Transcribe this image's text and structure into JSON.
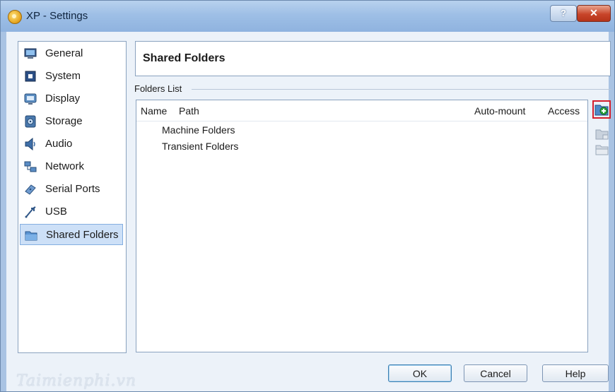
{
  "window": {
    "title": "XP - Settings",
    "help_glyph": "?",
    "close_glyph": "✕"
  },
  "sidebar": {
    "items": [
      {
        "label": "General",
        "icon": "monitor-icon"
      },
      {
        "label": "System",
        "icon": "chip-icon"
      },
      {
        "label": "Display",
        "icon": "display-icon"
      },
      {
        "label": "Storage",
        "icon": "storage-icon"
      },
      {
        "label": "Audio",
        "icon": "speaker-icon"
      },
      {
        "label": "Network",
        "icon": "network-icon"
      },
      {
        "label": "Serial Ports",
        "icon": "serial-port-icon"
      },
      {
        "label": "USB",
        "icon": "usb-icon"
      },
      {
        "label": "Shared Folders",
        "icon": "folder-icon",
        "selected": true
      }
    ]
  },
  "page": {
    "title": "Shared Folders"
  },
  "folders": {
    "group_label": "Folders List",
    "columns": [
      "Name",
      "Path",
      "Auto-mount",
      "Access"
    ],
    "rows": [
      "Machine Folders",
      "Transient Folders"
    ]
  },
  "toolbar": {
    "add_icon": "add-folder-icon",
    "edit_icon": "edit-folder-icon",
    "remove_icon": "remove-folder-icon"
  },
  "buttons": {
    "ok": "OK",
    "cancel": "Cancel",
    "help": "Help"
  },
  "watermark": "Taimienphi.vn",
  "colors": {
    "accent_selection": "#cde0f7",
    "highlight_border": "#d51f2b"
  }
}
